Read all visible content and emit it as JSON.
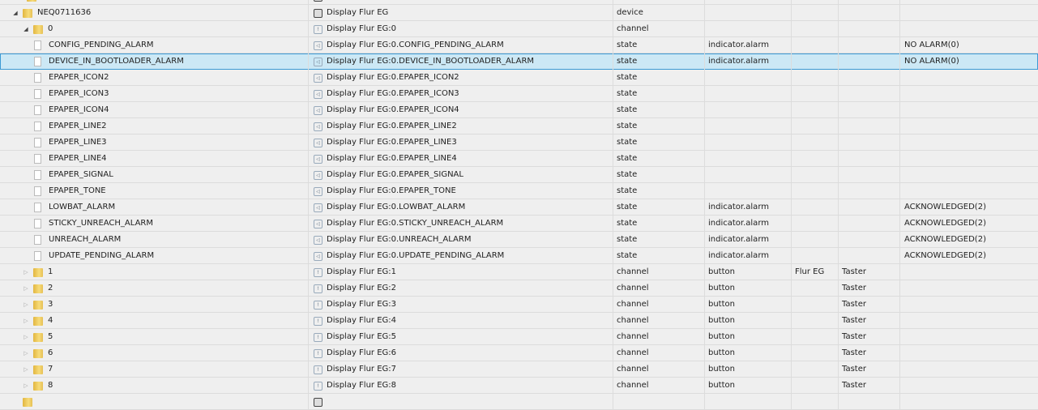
{
  "rows": [
    {
      "level": -1,
      "kind": "folder",
      "toggle": "",
      "id": "",
      "name": "",
      "icon": "device",
      "type": "",
      "role": "",
      "room": "",
      "func": "",
      "value": ""
    },
    {
      "level": 0,
      "kind": "folder",
      "toggle": "open",
      "id": "NEQ0711636",
      "name": "Display Flur EG",
      "icon": "device",
      "type": "device",
      "role": "",
      "room": "",
      "func": "",
      "value": ""
    },
    {
      "level": 1,
      "kind": "folder",
      "toggle": "open",
      "id": "0",
      "name": "Display Flur EG:0",
      "icon": "channel",
      "type": "channel",
      "role": "",
      "room": "",
      "func": "",
      "value": ""
    },
    {
      "level": 2,
      "kind": "file",
      "id": "CONFIG_PENDING_ALARM",
      "name": "Display Flur EG:0.CONFIG_PENDING_ALARM",
      "icon": "state",
      "type": "state",
      "role": "indicator.alarm",
      "room": "",
      "func": "",
      "value": "NO ALARM(0)"
    },
    {
      "level": 2,
      "kind": "file",
      "selected": true,
      "id": "DEVICE_IN_BOOTLOADER_ALARM",
      "name": "Display Flur EG:0.DEVICE_IN_BOOTLOADER_ALARM",
      "icon": "state",
      "type": "state",
      "role": "indicator.alarm",
      "room": "",
      "func": "",
      "value": "NO ALARM(0)"
    },
    {
      "level": 2,
      "kind": "file",
      "id": "EPAPER_ICON2",
      "name": "Display Flur EG:0.EPAPER_ICON2",
      "icon": "state",
      "type": "state",
      "role": "",
      "room": "",
      "func": "",
      "value": ""
    },
    {
      "level": 2,
      "kind": "file",
      "id": "EPAPER_ICON3",
      "name": "Display Flur EG:0.EPAPER_ICON3",
      "icon": "state",
      "type": "state",
      "role": "",
      "room": "",
      "func": "",
      "value": ""
    },
    {
      "level": 2,
      "kind": "file",
      "id": "EPAPER_ICON4",
      "name": "Display Flur EG:0.EPAPER_ICON4",
      "icon": "state",
      "type": "state",
      "role": "",
      "room": "",
      "func": "",
      "value": ""
    },
    {
      "level": 2,
      "kind": "file",
      "id": "EPAPER_LINE2",
      "name": "Display Flur EG:0.EPAPER_LINE2",
      "icon": "state",
      "type": "state",
      "role": "",
      "room": "",
      "func": "",
      "value": ""
    },
    {
      "level": 2,
      "kind": "file",
      "id": "EPAPER_LINE3",
      "name": "Display Flur EG:0.EPAPER_LINE3",
      "icon": "state",
      "type": "state",
      "role": "",
      "room": "",
      "func": "",
      "value": ""
    },
    {
      "level": 2,
      "kind": "file",
      "id": "EPAPER_LINE4",
      "name": "Display Flur EG:0.EPAPER_LINE4",
      "icon": "state",
      "type": "state",
      "role": "",
      "room": "",
      "func": "",
      "value": ""
    },
    {
      "level": 2,
      "kind": "file",
      "id": "EPAPER_SIGNAL",
      "name": "Display Flur EG:0.EPAPER_SIGNAL",
      "icon": "state",
      "type": "state",
      "role": "",
      "room": "",
      "func": "",
      "value": ""
    },
    {
      "level": 2,
      "kind": "file",
      "id": "EPAPER_TONE",
      "name": "Display Flur EG:0.EPAPER_TONE",
      "icon": "state",
      "type": "state",
      "role": "",
      "room": "",
      "func": "",
      "value": ""
    },
    {
      "level": 2,
      "kind": "file",
      "id": "LOWBAT_ALARM",
      "name": "Display Flur EG:0.LOWBAT_ALARM",
      "icon": "state",
      "type": "state",
      "role": "indicator.alarm",
      "room": "",
      "func": "",
      "value": "ACKNOWLEDGED(2)"
    },
    {
      "level": 2,
      "kind": "file",
      "id": "STICKY_UNREACH_ALARM",
      "name": "Display Flur EG:0.STICKY_UNREACH_ALARM",
      "icon": "state",
      "type": "state",
      "role": "indicator.alarm",
      "room": "",
      "func": "",
      "value": "ACKNOWLEDGED(2)"
    },
    {
      "level": 2,
      "kind": "file",
      "id": "UNREACH_ALARM",
      "name": "Display Flur EG:0.UNREACH_ALARM",
      "icon": "state",
      "type": "state",
      "role": "indicator.alarm",
      "room": "",
      "func": "",
      "value": "ACKNOWLEDGED(2)"
    },
    {
      "level": 2,
      "kind": "file",
      "id": "UPDATE_PENDING_ALARM",
      "name": "Display Flur EG:0.UPDATE_PENDING_ALARM",
      "icon": "state",
      "type": "state",
      "role": "indicator.alarm",
      "room": "",
      "func": "",
      "value": "ACKNOWLEDGED(2)"
    },
    {
      "level": 1,
      "kind": "folder",
      "toggle": "closed",
      "id": "1",
      "name": "Display Flur EG:1",
      "icon": "channel",
      "type": "channel",
      "role": "button",
      "room": "Flur EG",
      "func": "Taster",
      "value": ""
    },
    {
      "level": 1,
      "kind": "folder",
      "toggle": "closed",
      "id": "2",
      "name": "Display Flur EG:2",
      "icon": "channel",
      "type": "channel",
      "role": "button",
      "room": "",
      "func": "Taster",
      "value": ""
    },
    {
      "level": 1,
      "kind": "folder",
      "toggle": "closed",
      "id": "3",
      "name": "Display Flur EG:3",
      "icon": "channel",
      "type": "channel",
      "role": "button",
      "room": "",
      "func": "Taster",
      "value": ""
    },
    {
      "level": 1,
      "kind": "folder",
      "toggle": "closed",
      "id": "4",
      "name": "Display Flur EG:4",
      "icon": "channel",
      "type": "channel",
      "role": "button",
      "room": "",
      "func": "Taster",
      "value": ""
    },
    {
      "level": 1,
      "kind": "folder",
      "toggle": "closed",
      "id": "5",
      "name": "Display Flur EG:5",
      "icon": "channel",
      "type": "channel",
      "role": "button",
      "room": "",
      "func": "Taster",
      "value": ""
    },
    {
      "level": 1,
      "kind": "folder",
      "toggle": "closed",
      "id": "6",
      "name": "Display Flur EG:6",
      "icon": "channel",
      "type": "channel",
      "role": "button",
      "room": "",
      "func": "Taster",
      "value": ""
    },
    {
      "level": 1,
      "kind": "folder",
      "toggle": "closed",
      "id": "7",
      "name": "Display Flur EG:7",
      "icon": "channel",
      "type": "channel",
      "role": "button",
      "room": "",
      "func": "Taster",
      "value": ""
    },
    {
      "level": 1,
      "kind": "folder",
      "toggle": "closed",
      "id": "8",
      "name": "Display Flur EG:8",
      "icon": "channel",
      "type": "channel",
      "role": "button",
      "room": "",
      "func": "Taster",
      "value": ""
    },
    {
      "level": 0,
      "kind": "folder",
      "toggle": "",
      "id": "",
      "name": "",
      "icon": "device",
      "type": "",
      "role": "",
      "room": "",
      "func": "",
      "value": ""
    }
  ]
}
